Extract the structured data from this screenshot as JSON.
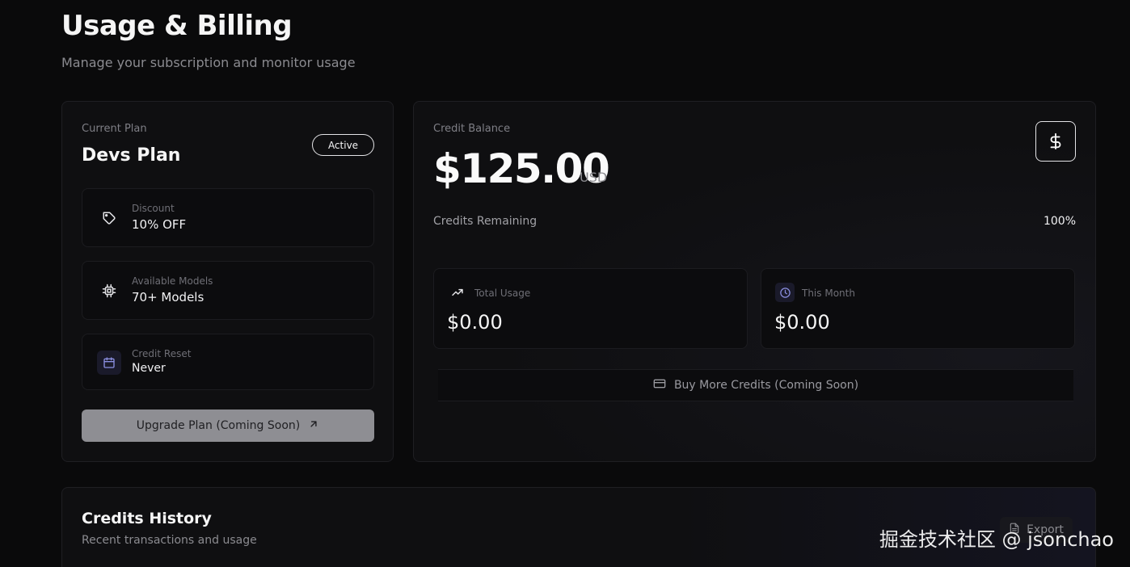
{
  "header": {
    "title": "Usage & Billing",
    "subtitle": "Manage your subscription and monitor usage"
  },
  "plan": {
    "label": "Current Plan",
    "name": "Devs Plan",
    "status": "Active",
    "features": [
      {
        "icon": "tag-icon",
        "label": "Discount",
        "value": "10% OFF"
      },
      {
        "icon": "cpu-chip-icon",
        "label": "Available Models",
        "value": "70+ Models"
      },
      {
        "icon": "calendar-icon",
        "label": "Credit Reset",
        "value": "Never"
      }
    ],
    "upgrade_label": "Upgrade Plan (Coming Soon)"
  },
  "balance": {
    "label": "Credit Balance",
    "amount": "$125.00",
    "currency": "USD",
    "remaining_label": "Credits Remaining",
    "remaining_percent": "100%",
    "stats": [
      {
        "icon": "trending-up-icon",
        "label": "Total Usage",
        "value": "$0.00"
      },
      {
        "icon": "clock-icon",
        "label": "This Month",
        "value": "$0.00"
      }
    ],
    "buy_label": "Buy More Credits (Coming Soon)"
  },
  "history": {
    "title": "Credits History",
    "subtitle": "Recent transactions and usage",
    "export_label": "Export"
  },
  "watermark": "掘金技术社区 @ jsonchao",
  "colors": {
    "background": "#0a0a0b",
    "card": "#0f0f11",
    "accent_tint": "#1a1a2a",
    "upgrade_button": "#8e8e93"
  }
}
